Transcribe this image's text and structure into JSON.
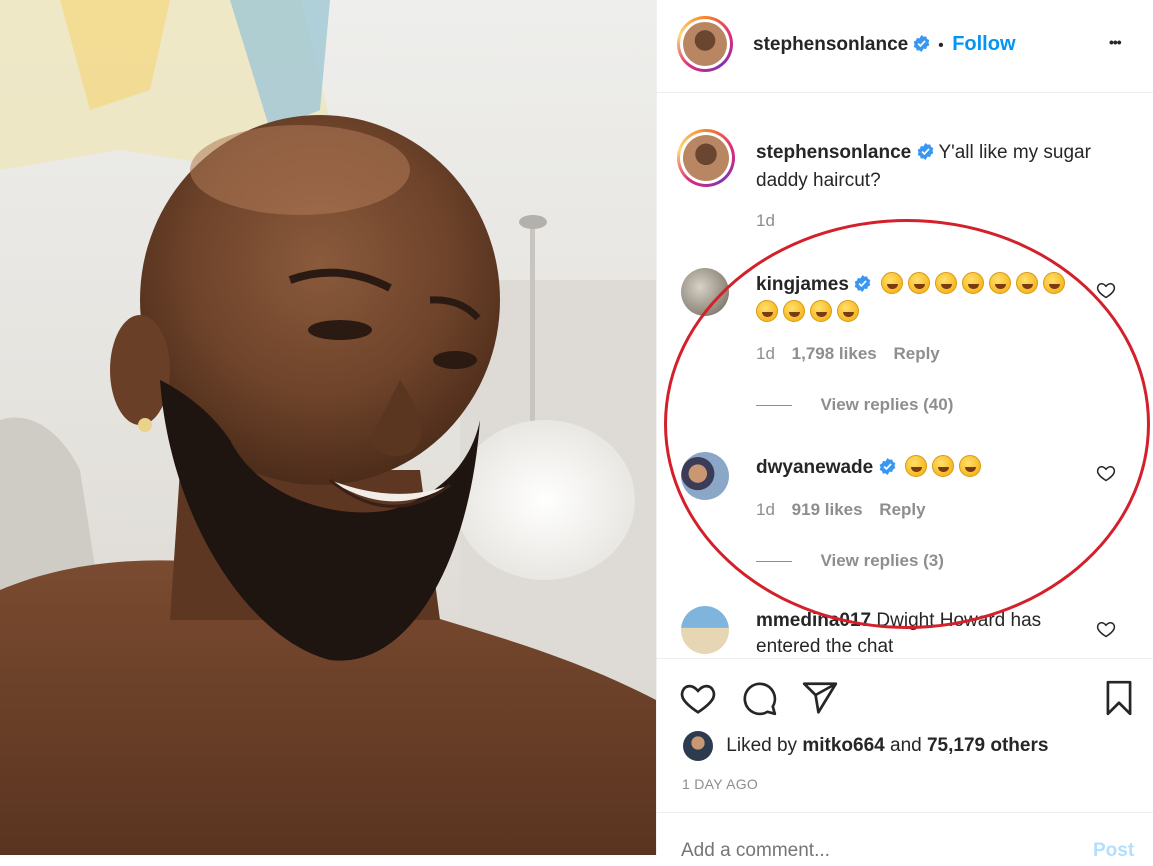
{
  "post": {
    "author": "stephensonlance",
    "separator": "•",
    "follow_label": "Follow",
    "more_label": "•••",
    "caption_text": "Y'all like my sugar daddy haircut?",
    "caption_age": "1d"
  },
  "comments": [
    {
      "username": "kingjames",
      "emoji_count": 11,
      "age": "1d",
      "likes": "1,798 likes",
      "reply_label": "Reply",
      "view_replies": "View replies (40)"
    },
    {
      "username": "dwyanewade",
      "emoji_count": 3,
      "age": "1d",
      "likes": "919 likes",
      "reply_label": "Reply",
      "view_replies": "View replies (3)"
    },
    {
      "username": "mmedina017",
      "text": "Dwight Howard has entered the chat"
    }
  ],
  "actions": {
    "liked_by_prefix": "Liked by",
    "liked_by_user": "mitko664",
    "liked_by_joiner": "and",
    "liked_by_count": "75,179 others",
    "timestamp": "1 DAY AGO"
  },
  "comment_box": {
    "placeholder": "Add a comment...",
    "post_label": "Post"
  },
  "colors": {
    "accent": "#0095f6",
    "annotation": "#d3202b",
    "muted": "#8e8e8e"
  }
}
